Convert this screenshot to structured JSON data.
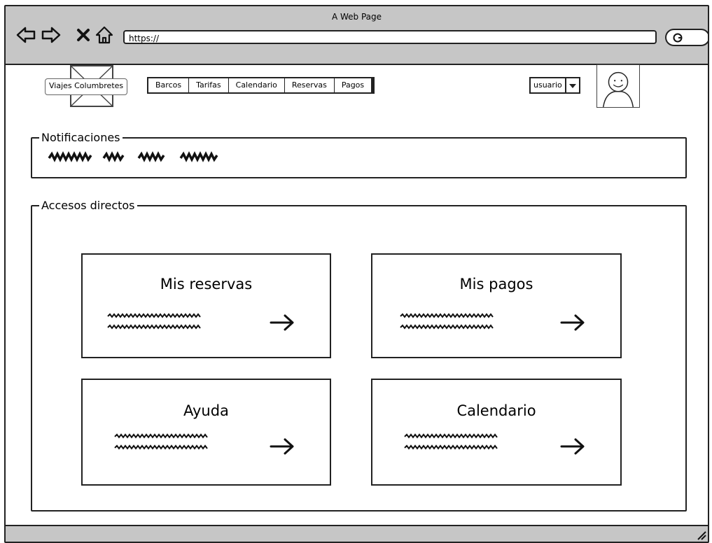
{
  "window": {
    "title": "A Web Page"
  },
  "browser": {
    "url": "https://",
    "icons": [
      "back-icon",
      "forward-icon",
      "stop-icon",
      "home-icon",
      "search-icon"
    ]
  },
  "header": {
    "logo_label": "Viajes Columbretes",
    "nav": [
      "Barcos",
      "Tarifas",
      "Calendario",
      "Reservas",
      "Pagos"
    ],
    "user_select": "usuario"
  },
  "notificaciones": {
    "legend": "Notificaciones"
  },
  "accesos": {
    "legend": "Accesos directos",
    "cards": [
      {
        "title": "Mis reservas",
        "arrow": "→"
      },
      {
        "title": "Mis pagos",
        "arrow": "→"
      },
      {
        "title": "Ayuda",
        "arrow": "→"
      },
      {
        "title": "Calendario",
        "arrow": "→"
      }
    ]
  }
}
